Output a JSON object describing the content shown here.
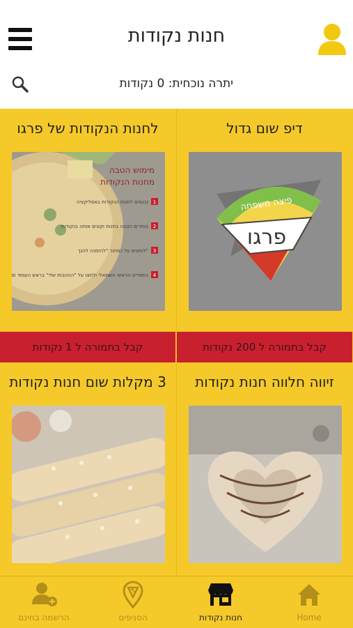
{
  "header": {
    "title": "חנות נקודות",
    "menu_icon": "hamburger-menu-icon",
    "profile_icon": "user-avatar-icon"
  },
  "balance": {
    "text": "יתרה נוכחית: 0 נקודות",
    "search_icon": "search-icon"
  },
  "products": [
    {
      "title": "דיפ שום גדול",
      "redeem": "קבל בתמורה ל 200 נקודות",
      "image": "pergo-pizza-logo"
    },
    {
      "title": "לחנות הנקודות של פרגו",
      "redeem": "קבל בתמורה ל 1 נקודות",
      "image": "points-store-flyer"
    },
    {
      "title": "זיווה חלווה חנות נקודות",
      "redeem": "",
      "image": "heart-pastry"
    },
    {
      "title": "3 מקלות שום חנות נקודות",
      "redeem": "",
      "image": "garlic-sticks"
    }
  ],
  "flyer": {
    "heading1": "מימוש הטבה",
    "heading2": "מחנות הנקודות",
    "steps": [
      {
        "num": "1",
        "text": "נכנסים לחנות הנקודות באפליקציה"
      },
      {
        "num": "2",
        "text": "בוחרים הטבה בחנות וקונים אותה בנקודות"
      },
      {
        "num": "3",
        "text": "לוחצים על כפתור \"להזמנה להנך\""
      },
      {
        "num": "4",
        "text": "בתפריט הראשי השמאלי ולחצו על \"ההטבות שלי\" בראש העמוד וספגו ב - 1 ההטבה מוכנה לסל קניות"
      }
    ]
  },
  "logo": {
    "top_text": "פיצה משפחה",
    "main_text": "פרגו"
  },
  "tabs": [
    {
      "label": "Home",
      "icon": "home-icon",
      "active": false
    },
    {
      "label": "חנות נקודות",
      "icon": "store-icon",
      "active": true
    },
    {
      "label": "הסניפים",
      "icon": "pizza-location-pin-icon",
      "active": false
    },
    {
      "label": "הרשמה בחינם",
      "icon": "add-user-icon",
      "active": false
    }
  ],
  "colors": {
    "accent_yellow": "#f5c929",
    "redeem_red": "#c8202f",
    "avatar_yellow": "#f2c811"
  }
}
